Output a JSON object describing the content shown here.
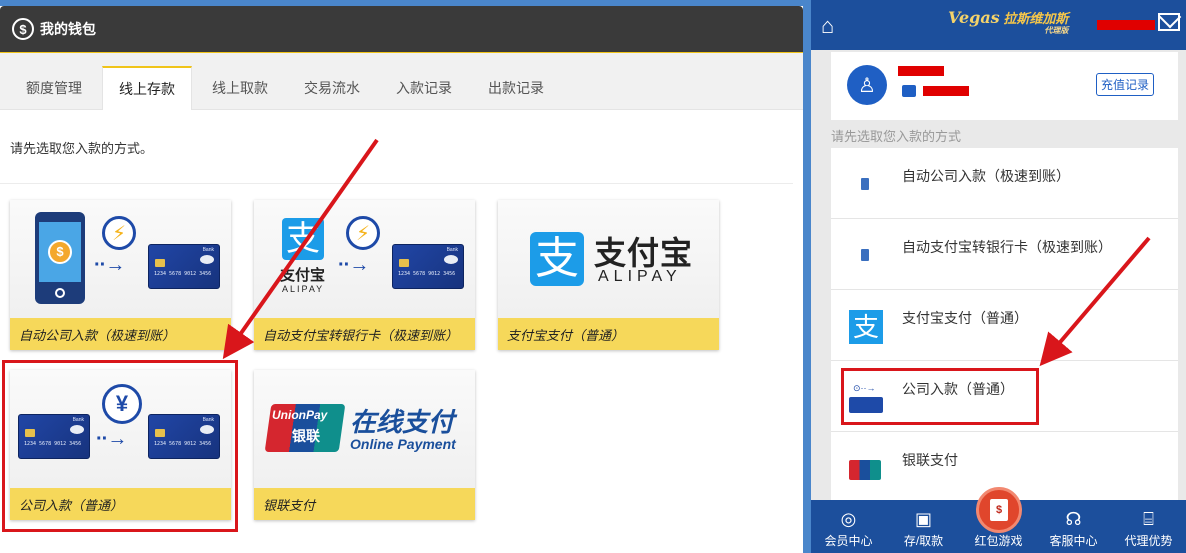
{
  "desktop": {
    "header_title": "我的钱包",
    "coin_icon": "$",
    "tabs": [
      {
        "label": "额度管理",
        "active": false
      },
      {
        "label": "线上存款",
        "active": true
      },
      {
        "label": "线上取款",
        "active": false
      },
      {
        "label": "交易流水",
        "active": false
      },
      {
        "label": "入款记录",
        "active": false
      },
      {
        "label": "出款记录",
        "active": false
      }
    ],
    "prompt": "请先选取您入款的方式。",
    "methods": [
      {
        "label": "自动公司入款（极速到账）",
        "icon": "phone-to-bank-icon"
      },
      {
        "label": "自动支付宝转银行卡（极速到账）",
        "icon": "alipay-to-bank-icon"
      },
      {
        "label": "支付宝支付（普通）",
        "icon": "alipay-logo-icon"
      },
      {
        "label": "公司入款（普通）",
        "icon": "bank-transfer-icon"
      },
      {
        "label": "银联支付",
        "icon": "unionpay-logo-icon"
      }
    ],
    "alipay_logo_cn": "支付宝",
    "alipay_logo_en": "ALIPAY",
    "alipay_small_cn": "支付宝",
    "alipay_small_en": "ALIPAY",
    "unionpay_logo_en": "UnionPay",
    "unionpay_logo_cn": "银联",
    "unionpay_text_cn": "在线支付",
    "unionpay_text_en": "Online Payment",
    "yen_symbol": "¥",
    "card_brand": "Bank",
    "card_number": "1234 5678 9012 3456"
  },
  "mobile": {
    "brand_name": "拉斯维加斯",
    "brand_sub": "代理版",
    "brand_vegas": "Vegas",
    "record_button": "充值记录",
    "prompt": "请先选取您入款的方式",
    "methods": [
      {
        "label": "自动公司入款（极速到账）",
        "icon": "phone-icon"
      },
      {
        "label": "自动支付宝转银行卡（极速到账）",
        "icon": "phone-icon"
      },
      {
        "label": "支付宝支付（普通）",
        "icon": "alipay-icon"
      },
      {
        "label": "公司入款（普通）",
        "icon": "bank-transfer-icon"
      },
      {
        "label": "银联支付",
        "icon": "unionpay-icon"
      }
    ],
    "nav": [
      {
        "label": "会员中心",
        "icon": "member-icon"
      },
      {
        "label": "存/取款",
        "icon": "deposit-icon"
      },
      {
        "label": "红包游戏",
        "icon": "red-envelope-icon"
      },
      {
        "label": "客服中心",
        "icon": "support-icon"
      },
      {
        "label": "代理优势",
        "icon": "gift-icon"
      }
    ]
  },
  "colors": {
    "desktop_header": "#3a3a3a",
    "accent_yellow": "#f6d85a",
    "mobile_header": "#1c4f9c",
    "annotation_red": "#d9161b"
  }
}
